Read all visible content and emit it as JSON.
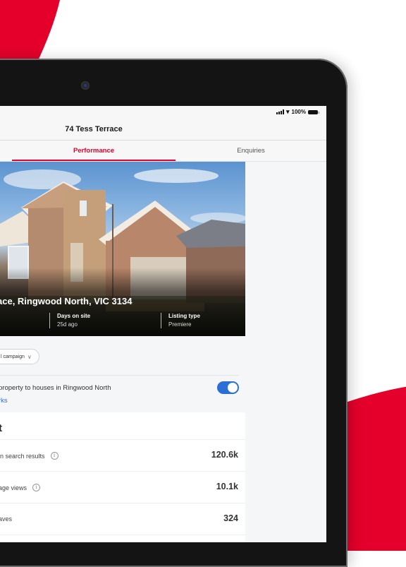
{
  "colors": {
    "brand_red": "#e4002b",
    "toggle_blue": "#2b6fd6",
    "bezel": "#141414"
  },
  "status_bar": {
    "battery_text": "100%",
    "icons": [
      "signal-icon",
      "wifi-icon",
      "battery-icon"
    ]
  },
  "nav": {
    "title": "74 Tess Terrace"
  },
  "tabs": [
    {
      "label": "Performance",
      "active": true
    },
    {
      "label": "Enquiries",
      "active": false
    }
  ],
  "hero": {
    "address": "ace, Ringwood North, VIC 3134",
    "stats": [
      {
        "label": "Days on site",
        "value": "25d ago"
      },
      {
        "label": "Listing type",
        "value": "Premiere"
      }
    ]
  },
  "campaign_selector": {
    "label": "l campaign",
    "icon": "chevron-down-icon"
  },
  "compare": {
    "text": "property to houses in Ringwood North",
    "link": "rks",
    "toggle_on": true
  },
  "card": {
    "title": "t",
    "rows": [
      {
        "label": "in search results",
        "value": "120.6k",
        "info": true
      },
      {
        "label": "age views",
        "value": "10.1k",
        "info": true
      },
      {
        "label": "aves",
        "value": "324",
        "info": false
      }
    ]
  }
}
